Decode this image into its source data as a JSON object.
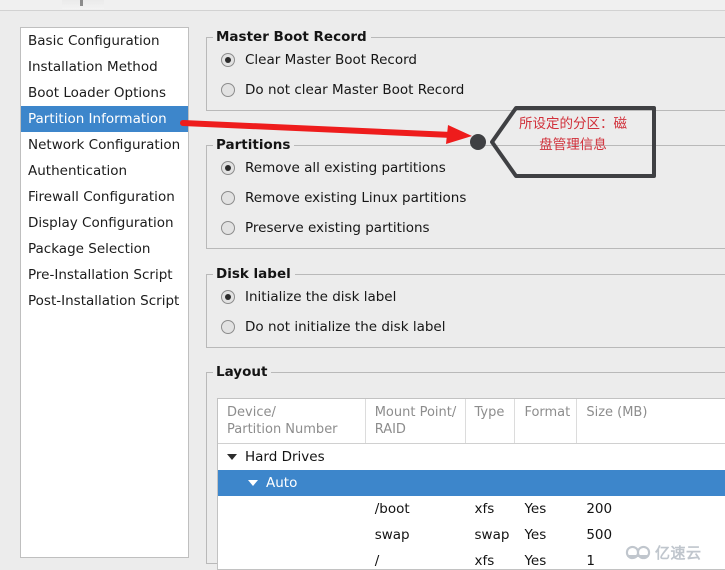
{
  "sidebar": {
    "items": [
      {
        "label": "Basic Configuration",
        "selected": false
      },
      {
        "label": "Installation Method",
        "selected": false
      },
      {
        "label": "Boot Loader Options",
        "selected": false
      },
      {
        "label": "Partition Information",
        "selected": true
      },
      {
        "label": "Network Configuration",
        "selected": false
      },
      {
        "label": "Authentication",
        "selected": false
      },
      {
        "label": "Firewall Configuration",
        "selected": false
      },
      {
        "label": "Display Configuration",
        "selected": false
      },
      {
        "label": "Package Selection",
        "selected": false
      },
      {
        "label": "Pre-Installation Script",
        "selected": false
      },
      {
        "label": "Post-Installation Script",
        "selected": false
      }
    ]
  },
  "mbr": {
    "legend": "Master Boot Record",
    "options": [
      {
        "label": "Clear Master Boot Record",
        "checked": true
      },
      {
        "label": "Do not clear Master Boot Record",
        "checked": false
      }
    ]
  },
  "partitions": {
    "legend": "Partitions",
    "options": [
      {
        "label": "Remove all existing partitions",
        "checked": true
      },
      {
        "label": "Remove existing Linux partitions",
        "checked": false
      },
      {
        "label": "Preserve existing partitions",
        "checked": false
      }
    ]
  },
  "disk_label": {
    "legend": "Disk label",
    "options": [
      {
        "label": "Initialize the disk label",
        "checked": true
      },
      {
        "label": "Do not initialize the disk label",
        "checked": false
      }
    ]
  },
  "layout": {
    "legend": "Layout",
    "columns": [
      "Device/\nPartition Number",
      "Mount Point/\nRAID",
      "Type",
      "Format",
      "Size (MB)"
    ],
    "rows": [
      {
        "device": "Hard Drives",
        "mount": "",
        "type": "",
        "format": "",
        "size": "",
        "indent": 1,
        "expander": true,
        "selected": false
      },
      {
        "device": "Auto",
        "mount": "",
        "type": "",
        "format": "",
        "size": "",
        "indent": 2,
        "expander": true,
        "selected": true
      },
      {
        "device": "",
        "mount": "/boot",
        "type": "xfs",
        "format": "Yes",
        "size": "200",
        "indent": 0,
        "expander": false,
        "selected": false
      },
      {
        "device": "",
        "mount": "swap",
        "type": "swap",
        "format": "Yes",
        "size": "500",
        "indent": 0,
        "expander": false,
        "selected": false
      },
      {
        "device": "",
        "mount": "/",
        "type": "xfs",
        "format": "Yes",
        "size": "1",
        "indent": 0,
        "expander": false,
        "selected": false
      }
    ]
  },
  "annotations": {
    "arrow_color": "#ee1c1c",
    "callout_text": "所设定的分区：磁\n盘管理信息",
    "callout_text_color": "#d1303a",
    "callout_border_color": "#3f4043"
  },
  "watermark": {
    "text": "亿速云"
  },
  "colors": {
    "selection_blue": "#3d86cb",
    "window_bg": "#ececec",
    "list_bg": "#ffffff"
  }
}
